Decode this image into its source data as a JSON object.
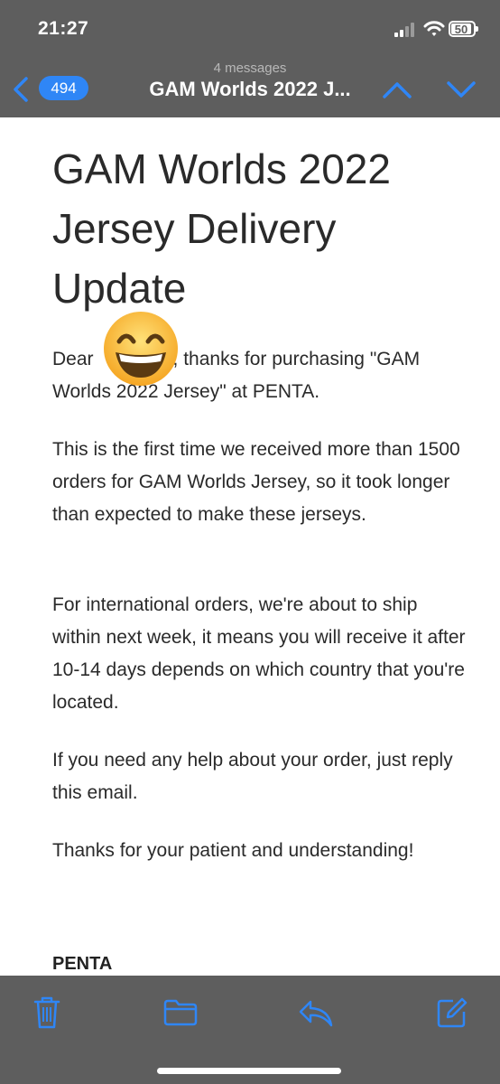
{
  "status_bar": {
    "time": "21:27",
    "battery": "50"
  },
  "nav_bar": {
    "unread_count": "494",
    "message_count": "4 messages",
    "title": "GAM Worlds 2022 J..."
  },
  "email": {
    "heading": "GAM Worlds 2022 Jersey Delivery Update",
    "greeting": "Dear",
    "greeting_rest": ", thanks for purchasing \"GAM Worlds 2022 Jersey\" at PENTA.",
    "paragraphs": [
      "This is the first time we received more than 1500 orders for GAM Worlds Jersey, so it took longer than expected to make these jerseys.",
      "For international orders, we're about to ship within next week, it means you will receive it after 10-14 days depends on which country that you're located.",
      "If you need any help about your order, just reply this email.",
      "Thanks for your patient and understanding!"
    ],
    "signoff": "PENTA"
  },
  "toolbar": {
    "icons": [
      "trash-icon",
      "folder-icon",
      "reply-icon",
      "compose-icon"
    ]
  },
  "colors": {
    "bar_background": "#5e5e5e",
    "accent_blue": "#2f86f6",
    "body_text": "#2a2a2a"
  }
}
